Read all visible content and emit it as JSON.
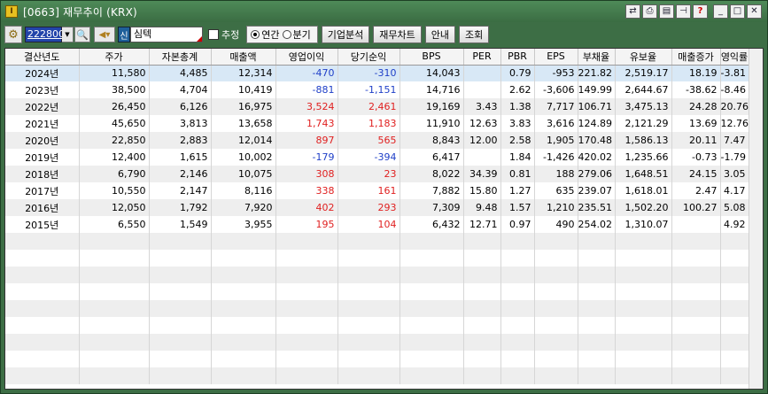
{
  "window": {
    "title": "[0663] 재무추이 (KRX)"
  },
  "toolbar": {
    "stock_code": "222800",
    "stock_badge": "신",
    "stock_name": "심텍",
    "estimate_label": "추정",
    "radio_annual": "연간",
    "radio_quarter": "분기",
    "btn_company_analysis": "기업분석",
    "btn_finance_chart": "재무차트",
    "btn_guide": "안내",
    "btn_query": "조회"
  },
  "icons": {
    "app": "app-icon",
    "gear": "gear-icon",
    "dropdown": "chevron-down-icon",
    "search": "search-icon",
    "speaker": "speaker-icon",
    "title_buttons": [
      "link-icon",
      "print-icon",
      "save-icon",
      "pin-icon",
      "help-icon",
      "minimize-icon",
      "maximize-icon",
      "close-icon"
    ]
  },
  "colors": {
    "positive": "#e02020",
    "negative": "#2040c8",
    "selected_row": "#d8e8f6",
    "title_bar": "#3d6e45"
  },
  "table": {
    "headers": [
      "결산년도",
      "주가",
      "자본총계",
      "매출액",
      "영업이익",
      "당기순익",
      "BPS",
      "PER",
      "PBR",
      "EPS",
      "부채율",
      "유보율",
      "매출증가",
      "영익률"
    ],
    "rows": [
      {
        "cells": [
          "2024년",
          "11,580",
          "4,485",
          "12,314",
          "-470",
          "-310",
          "14,043",
          "",
          "0.79",
          "-953",
          "221.82",
          "2,519.17",
          "18.19",
          "-3.81"
        ],
        "tones": [
          "",
          "",
          "",
          "",
          "neg",
          "neg",
          "",
          "",
          "",
          "",
          "",
          "",
          "",
          ""
        ]
      },
      {
        "cells": [
          "2023년",
          "38,500",
          "4,704",
          "10,419",
          "-881",
          "-1,151",
          "14,716",
          "",
          "2.62",
          "-3,606",
          "149.99",
          "2,644.67",
          "-38.62",
          "-8.46"
        ],
        "tones": [
          "",
          "",
          "",
          "",
          "neg",
          "neg",
          "",
          "",
          "",
          "",
          "",
          "",
          "",
          ""
        ]
      },
      {
        "cells": [
          "2022년",
          "26,450",
          "6,126",
          "16,975",
          "3,524",
          "2,461",
          "19,169",
          "3.43",
          "1.38",
          "7,717",
          "106.71",
          "3,475.13",
          "24.28",
          "20.76"
        ],
        "tones": [
          "",
          "",
          "",
          "",
          "pos",
          "pos",
          "",
          "",
          "",
          "",
          "",
          "",
          "",
          ""
        ]
      },
      {
        "cells": [
          "2021년",
          "45,650",
          "3,813",
          "13,658",
          "1,743",
          "1,183",
          "11,910",
          "12.63",
          "3.83",
          "3,616",
          "124.89",
          "2,121.29",
          "13.69",
          "12.76"
        ],
        "tones": [
          "",
          "",
          "",
          "",
          "pos",
          "pos",
          "",
          "",
          "",
          "",
          "",
          "",
          "",
          ""
        ]
      },
      {
        "cells": [
          "2020년",
          "22,850",
          "2,883",
          "12,014",
          "897",
          "565",
          "8,843",
          "12.00",
          "2.58",
          "1,905",
          "170.48",
          "1,586.13",
          "20.11",
          "7.47"
        ],
        "tones": [
          "",
          "",
          "",
          "",
          "pos",
          "pos",
          "",
          "",
          "",
          "",
          "",
          "",
          "",
          ""
        ]
      },
      {
        "cells": [
          "2019년",
          "12,400",
          "1,615",
          "10,002",
          "-179",
          "-394",
          "6,417",
          "",
          "1.84",
          "-1,426",
          "420.02",
          "1,235.66",
          "-0.73",
          "-1.79"
        ],
        "tones": [
          "",
          "",
          "",
          "",
          "neg",
          "neg",
          "",
          "",
          "",
          "",
          "",
          "",
          "",
          ""
        ]
      },
      {
        "cells": [
          "2018년",
          "6,790",
          "2,146",
          "10,075",
          "308",
          "23",
          "8,022",
          "34.39",
          "0.81",
          "188",
          "279.06",
          "1,648.51",
          "24.15",
          "3.05"
        ],
        "tones": [
          "",
          "",
          "",
          "",
          "pos",
          "pos",
          "",
          "",
          "",
          "",
          "",
          "",
          "",
          ""
        ]
      },
      {
        "cells": [
          "2017년",
          "10,550",
          "2,147",
          "8,116",
          "338",
          "161",
          "7,882",
          "15.80",
          "1.27",
          "635",
          "239.07",
          "1,618.01",
          "2.47",
          "4.17"
        ],
        "tones": [
          "",
          "",
          "",
          "",
          "pos",
          "pos",
          "",
          "",
          "",
          "",
          "",
          "",
          "",
          ""
        ]
      },
      {
        "cells": [
          "2016년",
          "12,050",
          "1,792",
          "7,920",
          "402",
          "293",
          "7,309",
          "9.48",
          "1.57",
          "1,210",
          "235.51",
          "1,502.20",
          "100.27",
          "5.08"
        ],
        "tones": [
          "",
          "",
          "",
          "",
          "pos",
          "pos",
          "",
          "",
          "",
          "",
          "",
          "",
          "",
          ""
        ]
      },
      {
        "cells": [
          "2015년",
          "6,550",
          "1,549",
          "3,955",
          "195",
          "104",
          "6,432",
          "12.71",
          "0.97",
          "490",
          "254.02",
          "1,310.07",
          "",
          "4.92"
        ],
        "tones": [
          "",
          "",
          "",
          "",
          "pos",
          "pos",
          "",
          "",
          "",
          "",
          "",
          "",
          "",
          ""
        ]
      }
    ]
  }
}
